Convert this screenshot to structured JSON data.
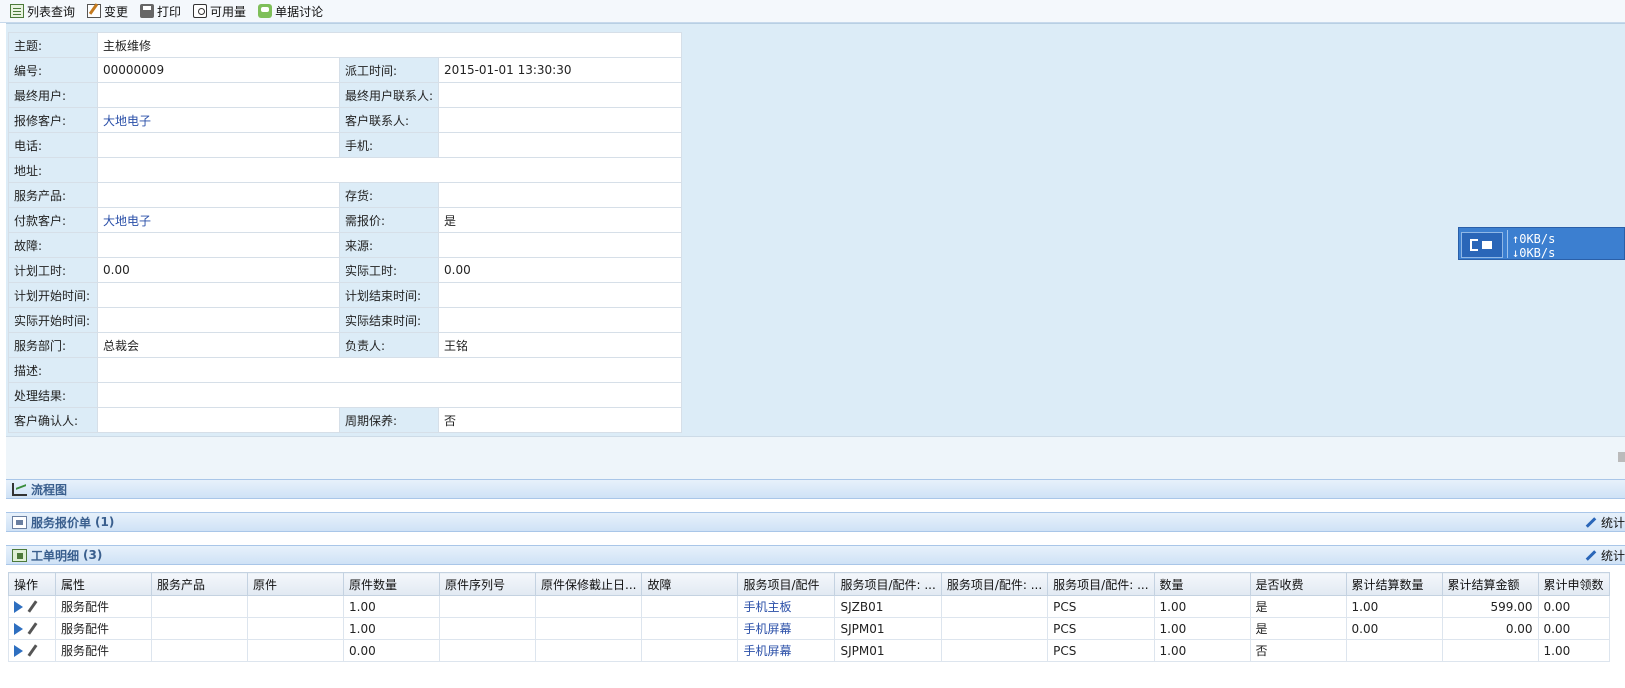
{
  "toolbar": {
    "list_query": "列表查询",
    "change": "变更",
    "print": "打印",
    "available": "可用量",
    "discuss": "单据讨论"
  },
  "form": {
    "subject_label": "主题:",
    "subject_value": "主板维修",
    "code_label": "编号:",
    "code_value": "00000009",
    "dispatch_time_label": "派工时间:",
    "dispatch_time_value": "2015-01-01 13:30:30",
    "end_user_label": "最终用户:",
    "end_user_value": "",
    "end_user_contact_label": "最终用户联系人:",
    "end_user_contact_value": "",
    "repair_customer_label": "报修客户:",
    "repair_customer_value": "大地电子",
    "customer_contact_label": "客户联系人:",
    "customer_contact_value": "",
    "phone_label": "电话:",
    "phone_value": "",
    "mobile_label": "手机:",
    "mobile_value": "",
    "address_label": "地址:",
    "address_value": "",
    "service_product_label": "服务产品:",
    "service_product_value": "",
    "inventory_label": "存货:",
    "inventory_value": "",
    "pay_customer_label": "付款客户:",
    "pay_customer_value": "大地电子",
    "need_quote_label": "需报价:",
    "need_quote_value": "是",
    "fault_label": "故障:",
    "fault_value": "",
    "source_label": "来源:",
    "source_value": "",
    "plan_hours_label": "计划工时:",
    "plan_hours_value": "0.00",
    "actual_hours_label": "实际工时:",
    "actual_hours_value": "0.00",
    "plan_start_label": "计划开始时间:",
    "plan_start_value": "",
    "plan_end_label": "计划结束时间:",
    "plan_end_value": "",
    "actual_start_label": "实际开始时间:",
    "actual_start_value": "",
    "actual_end_label": "实际结束时间:",
    "actual_end_value": "",
    "service_dept_label": "服务部门:",
    "service_dept_value": "总裁会",
    "owner_label": "负责人:",
    "owner_value": "王铭",
    "desc_label": "描述:",
    "desc_value": "",
    "result_label": "处理结果:",
    "result_value": "",
    "confirm_label": "客户确认人:",
    "confirm_value": "",
    "periodic_label": "周期保养:",
    "periodic_value": "否"
  },
  "net_widget": {
    "up": "0KB/s",
    "down": "0KB/s"
  },
  "panels": {
    "flow_title": "流程图",
    "quote_title": "服务报价单",
    "quote_count": "(1)",
    "detail_title": "工单明细",
    "detail_count": "(3)",
    "stat_label": "统计"
  },
  "grid": {
    "headers": [
      "操作",
      "属性",
      "服务产品",
      "原件",
      "原件数量",
      "原件序列号",
      "原件保修截止日...",
      "故障",
      "服务项目/配件",
      "服务项目/配件: ...",
      "服务项目/配件: ...",
      "服务项目/配件: ...",
      "数量",
      "是否收费",
      "累计结算数量",
      "累计结算金额",
      "累计申领数"
    ],
    "rows": [
      {
        "attr": "服务配件",
        "product": "",
        "orig": "",
        "orig_qty": "1.00",
        "orig_sn": "",
        "warranty": "",
        "fault": "",
        "item": "手机主板",
        "item_code": "SJZB01",
        "item_spec": "",
        "unit": "PCS",
        "qty": "1.00",
        "charge": "是",
        "settle_qty": "1.00",
        "settle_amt": "599.00",
        "apply_qty": "0.00"
      },
      {
        "attr": "服务配件",
        "product": "",
        "orig": "",
        "orig_qty": "1.00",
        "orig_sn": "",
        "warranty": "",
        "fault": "",
        "item": "手机屏幕",
        "item_code": "SJPM01",
        "item_spec": "",
        "unit": "PCS",
        "qty": "1.00",
        "charge": "是",
        "settle_qty": "0.00",
        "settle_amt": "0.00",
        "apply_qty": "0.00"
      },
      {
        "attr": "服务配件",
        "product": "",
        "orig": "",
        "orig_qty": "0.00",
        "orig_sn": "",
        "warranty": "",
        "fault": "",
        "item": "手机屏幕",
        "item_code": "SJPM01",
        "item_spec": "",
        "unit": "PCS",
        "qty": "1.00",
        "charge": "否",
        "settle_qty": "",
        "settle_amt": "",
        "apply_qty": "1.00"
      }
    ]
  }
}
